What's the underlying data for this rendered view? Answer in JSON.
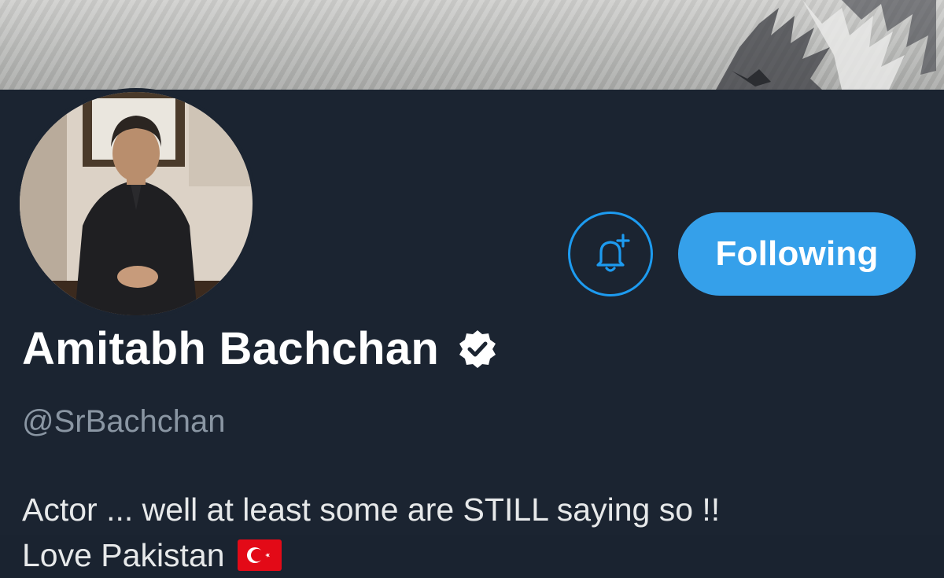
{
  "profile": {
    "display_name": "Amitabh Bachchan",
    "handle": "@SrBachchan",
    "verified": true,
    "bio_line1": "Actor ... well at least some are STILL saying so !!",
    "bio_line2": "Love Pakistan",
    "bio_flag_icon": "turkey-flag-icon"
  },
  "actions": {
    "notify_icon": "bell-plus-icon",
    "follow_label": "Following"
  },
  "colors": {
    "background": "#1b2431",
    "accent": "#35a0ea",
    "handle_text": "#8a96a3",
    "flag_red": "#e30a17"
  }
}
